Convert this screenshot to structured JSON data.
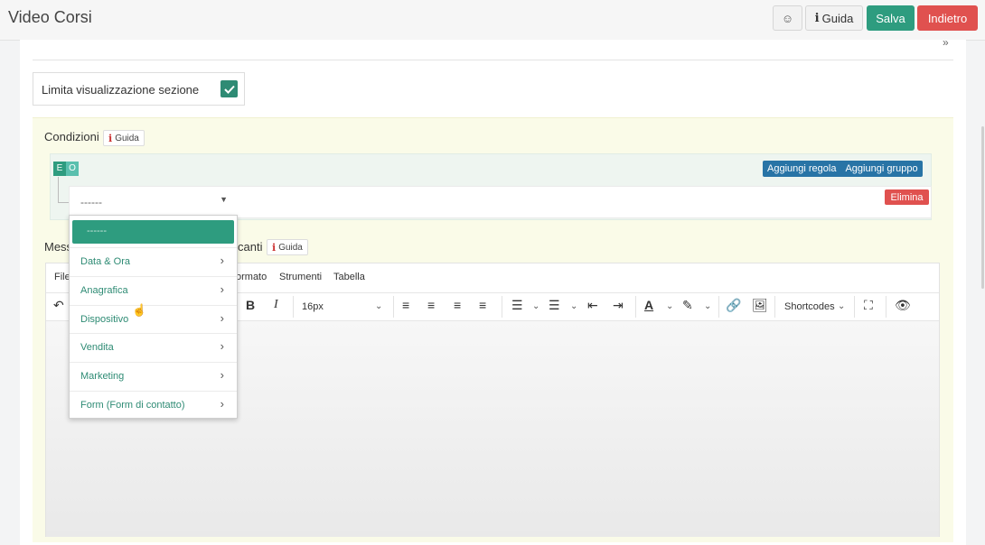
{
  "header": {
    "title": "Video Corsi",
    "emoji_icon": "☺",
    "guida_label": "Guida",
    "salva_label": "Salva",
    "indietro_label": "Indietro"
  },
  "limit": {
    "label": "Limita visualizzazione sezione",
    "checked": true
  },
  "conditions": {
    "title": "Condizioni",
    "guida_label": "Guida",
    "and_label": "E",
    "or_label": "O",
    "add_rule_label": "Aggiungi regola",
    "add_group_label": "Aggiungi gruppo",
    "select_value": "------",
    "delete_label": "Elimina"
  },
  "dropdown": {
    "selected": "------",
    "items": [
      {
        "label": "Data & Ora"
      },
      {
        "label": "Anagrafica"
      },
      {
        "label": "Dispositivo"
      },
      {
        "label": "Vendita"
      },
      {
        "label": "Marketing"
      },
      {
        "label": "Form (Form di contatto)"
      }
    ]
  },
  "message": {
    "label_start": "Mess",
    "label_end": "canti",
    "guida_label": "Guida"
  },
  "editor": {
    "menu": [
      "File",
      "ormato",
      "Strumenti",
      "Tabella"
    ],
    "font_size": "16px",
    "shortcodes_label": "Shortcodes"
  },
  "colors": {
    "primary_green": "#2e9c7f",
    "danger_red": "#e0514f",
    "blue": "#2874a6"
  }
}
